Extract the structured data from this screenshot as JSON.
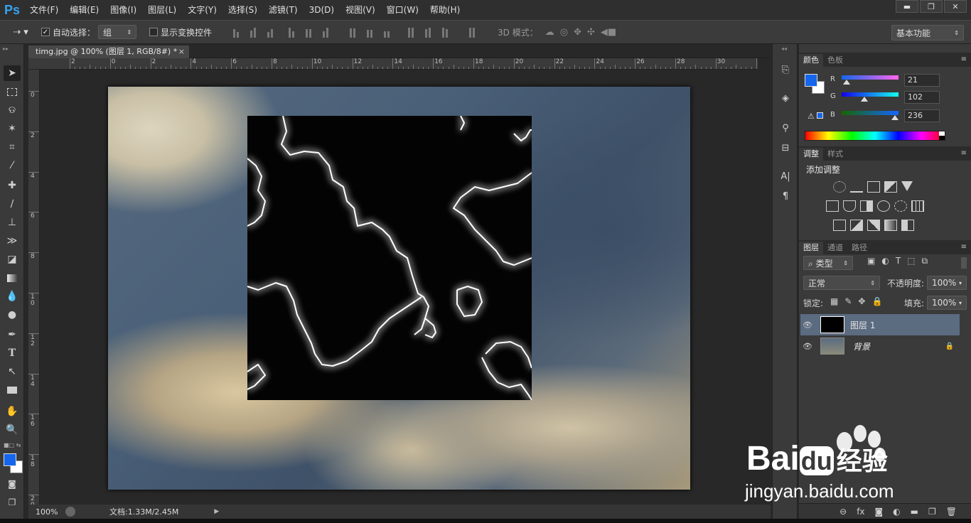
{
  "app": {
    "logo": "Ps",
    "menus": [
      "文件(F)",
      "编辑(E)",
      "图像(I)",
      "图层(L)",
      "文字(Y)",
      "选择(S)",
      "滤镜(T)",
      "3D(D)",
      "视图(V)",
      "窗口(W)",
      "帮助(H)"
    ],
    "window_controls": {
      "minimize": "▬",
      "restore": "❐",
      "close": "✕"
    }
  },
  "options_bar": {
    "auto_select_label": "自动选择：",
    "auto_select_checked": true,
    "auto_select_value": "组",
    "show_transform_label": "显示变换控件",
    "show_transform_checked": false,
    "mode_3d_label": "3D 模式：",
    "workspace": "基本功能"
  },
  "document": {
    "tab_title": "timg.jpg @ 100% (图层 1, RGB/8#) *",
    "tab_close": "×",
    "ruler_top_labels": [
      "2",
      "0",
      "2",
      "4",
      "6",
      "8",
      "10",
      "12",
      "14",
      "16",
      "18",
      "20",
      "22",
      "24",
      "26",
      "28",
      "30",
      "3"
    ],
    "ruler_left_labels": [
      "0",
      "2",
      "4",
      "6",
      "8",
      "10",
      "12",
      "14",
      "16",
      "18",
      "20"
    ]
  },
  "status": {
    "zoom": "100%",
    "doc_info": "文档:1.33M/2.45M"
  },
  "color_panel": {
    "tabs": [
      "颜色",
      "色板"
    ],
    "r_label": "R",
    "g_label": "G",
    "b_label": "B",
    "r": "21",
    "g": "102",
    "b": "236",
    "foreground": "#1566ec",
    "background": "#ffffff"
  },
  "adjust_panel": {
    "tabs": [
      "调整",
      "样式"
    ],
    "title": "添加调整"
  },
  "layers_panel": {
    "tabs": [
      "图层",
      "通道",
      "路径"
    ],
    "filter_kind": "类型",
    "blend_mode": "正常",
    "opacity_label": "不透明度:",
    "opacity": "100%",
    "lock_label": "锁定:",
    "fill_label": "填充:",
    "fill": "100%",
    "layers": [
      {
        "name": "图层 1",
        "selected": true
      },
      {
        "name": "背景",
        "locked": true
      }
    ]
  },
  "watermark": {
    "brand": "Bai",
    "brand_du": "du",
    "brand_cn": "经验",
    "url": "jingyan.baidu.com"
  },
  "icons": {
    "move": "move-tool-icon",
    "marquee": "marquee-tool-icon",
    "lasso": "lasso-tool-icon",
    "wand": "magic-wand-icon",
    "crop": "crop-tool-icon",
    "eyedropper": "eyedropper-icon",
    "heal": "healing-brush-icon",
    "brush": "brush-tool-icon",
    "stamp": "clone-stamp-icon",
    "history": "history-brush-icon",
    "eraser": "eraser-icon",
    "gradient": "gradient-tool-icon",
    "blur": "blur-tool-icon",
    "dodge": "dodge-tool-icon",
    "pen": "pen-tool-icon",
    "type": "type-tool-icon",
    "path": "path-select-icon",
    "shape": "rectangle-tool-icon",
    "hand": "hand-tool-icon",
    "zoom": "zoom-tool-icon"
  }
}
